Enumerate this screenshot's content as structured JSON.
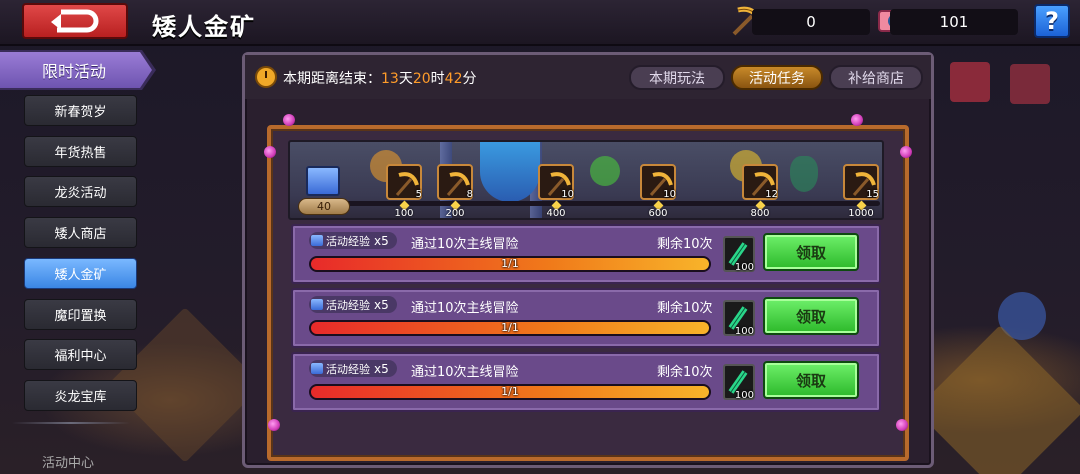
{
  "header": {
    "title": "矮人金矿",
    "pickaxe_count": "0",
    "gem_count": "101",
    "help_label": "?"
  },
  "sidebar": {
    "heading": "限时活动",
    "items": [
      {
        "label": "新春贺岁",
        "active": false
      },
      {
        "label": "年货热售",
        "active": false
      },
      {
        "label": "龙炎活动",
        "active": false
      },
      {
        "label": "矮人商店",
        "active": false
      },
      {
        "label": "矮人金矿",
        "active": true
      },
      {
        "label": "魔印置换",
        "active": false
      },
      {
        "label": "福利中心",
        "active": false
      },
      {
        "label": "炎龙宝库",
        "active": false
      }
    ],
    "more_label": "活动中心"
  },
  "panel": {
    "timer_label": "本期距离结束：",
    "timer_days": "13",
    "timer_days_unit": "天",
    "timer_hours": "20",
    "timer_hours_unit": "时",
    "timer_minutes": "42",
    "timer_minutes_unit": "分",
    "tabs": [
      {
        "label": "本期玩法",
        "active": false
      },
      {
        "label": "活动任务",
        "active": true
      },
      {
        "label": "补给商店",
        "active": false
      }
    ]
  },
  "track": {
    "level": "40",
    "progress": 0.0,
    "rewards": [
      {
        "qty": "5",
        "milestone": "100"
      },
      {
        "qty": "8",
        "milestone": "200"
      },
      {
        "qty": "10",
        "milestone": "400"
      },
      {
        "qty": "10",
        "milestone": "600"
      },
      {
        "qty": "12",
        "milestone": "800"
      },
      {
        "qty": "15",
        "milestone": "1000"
      }
    ]
  },
  "tasks": [
    {
      "tag": "活动经验",
      "multiplier": "x5",
      "desc": "通过10次主线冒险",
      "remain": "剩余10次",
      "progress_text": "1/1",
      "progress": 1.0,
      "reward_qty": "100",
      "claim_label": "领取"
    },
    {
      "tag": "活动经验",
      "multiplier": "x5",
      "desc": "通过10次主线冒险",
      "remain": "剩余10次",
      "progress_text": "1/1",
      "progress": 1.0,
      "reward_qty": "100",
      "claim_label": "领取"
    },
    {
      "tag": "活动经验",
      "multiplier": "x5",
      "desc": "通过10次主线冒险",
      "remain": "剩余10次",
      "progress_text": "1/1",
      "progress": 1.0,
      "reward_qty": "100",
      "claim_label": "领取"
    }
  ],
  "colors": {
    "accent_orange": "#ff9c2a",
    "claim_green": "#2cb82a",
    "active_side": "#3a86e4"
  }
}
